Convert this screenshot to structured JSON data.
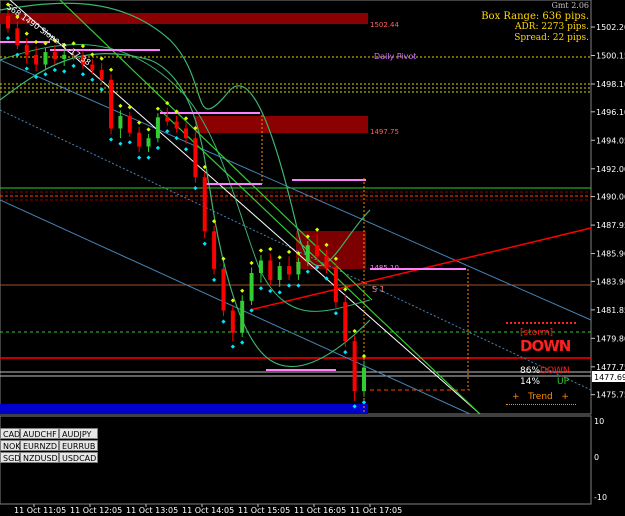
{
  "info_panel": {
    "top_label": "Gmt 2.06",
    "box_range": "Box Range: 636 pips.",
    "adr": "ADR: 2273 pips.",
    "spread": "Spread: 22 pips."
  },
  "trendline_label": "1490 Slope = -17.38",
  "trendline_prefix": "S68",
  "daily_pivot_label": "Daily Pivot",
  "s1_label": "S 1",
  "price_tags": [
    "1502.44",
    "1497.75",
    "1485.10"
  ],
  "current_price": "1477.69",
  "storm_label": "[storm]",
  "down_big": "DOWN",
  "pct_down": "86%",
  "down_word": "DOWN",
  "pct_up": "14%",
  "up_word": "UP",
  "trend_label": "+   Trend   +",
  "lower_axis": [
    "10",
    "0",
    "-10"
  ],
  "pair_buttons": [
    [
      "CAD",
      "AUDCHF",
      "AUDJPY"
    ],
    [
      "NOK",
      "EURNZD",
      "EURRUB"
    ],
    [
      "SGD",
      "NZDUSD",
      "USDCAD"
    ]
  ],
  "chart_data": {
    "type": "candlestick",
    "ylim": [
      1474.5,
      1504
    ],
    "y_ticks": [
      "1502.20",
      "1500.15",
      "1498.10",
      "1496.10",
      "1494.05",
      "1492.00",
      "1490.00",
      "1487.95",
      "1485.90",
      "1483.90",
      "1481.85",
      "1479.80",
      "1477.75",
      "1475.75"
    ],
    "x_ticks": [
      "11 Oct 11:05",
      "11 Oct 12:05",
      "11 Oct 13:05",
      "11 Oct 14:05",
      "11 Oct 15:05",
      "11 Oct 16:05",
      "11 Oct 17:05"
    ],
    "up_color": "#32cd32",
    "down_color": "#ff0000",
    "candles": [
      [
        1503.0,
        1503.5,
        1501.8,
        1502.1
      ],
      [
        1502.1,
        1502.6,
        1500.6,
        1500.9
      ],
      [
        1500.9,
        1501.4,
        1499.6,
        1500.2
      ],
      [
        1500.2,
        1500.8,
        1499.0,
        1499.5
      ],
      [
        1499.5,
        1500.7,
        1499.2,
        1500.4
      ],
      [
        1500.4,
        1500.9,
        1499.5,
        1499.9
      ],
      [
        1499.9,
        1500.6,
        1499.4,
        1500.2
      ],
      [
        1500.2,
        1500.7,
        1499.8,
        1500.1
      ],
      [
        1500.1,
        1500.5,
        1499.2,
        1499.5
      ],
      [
        1499.5,
        1499.9,
        1498.8,
        1499.1
      ],
      [
        1499.1,
        1499.6,
        1498.1,
        1498.4
      ],
      [
        1498.4,
        1498.8,
        1494.5,
        1494.9
      ],
      [
        1494.9,
        1496.2,
        1494.2,
        1495.8
      ],
      [
        1495.8,
        1496.1,
        1494.3,
        1494.6
      ],
      [
        1494.6,
        1495.0,
        1493.2,
        1493.6
      ],
      [
        1493.6,
        1494.5,
        1493.2,
        1494.2
      ],
      [
        1494.2,
        1496.0,
        1493.9,
        1495.7
      ],
      [
        1495.7,
        1496.4,
        1495.1,
        1495.4
      ],
      [
        1495.4,
        1495.8,
        1494.6,
        1494.9
      ],
      [
        1494.9,
        1495.3,
        1493.8,
        1494.2
      ],
      [
        1494.2,
        1494.6,
        1491.0,
        1491.4
      ],
      [
        1491.4,
        1491.8,
        1487.0,
        1487.5
      ],
      [
        1487.5,
        1487.9,
        1484.4,
        1484.8
      ],
      [
        1484.8,
        1485.2,
        1481.4,
        1481.8
      ],
      [
        1481.8,
        1482.2,
        1479.6,
        1480.2
      ],
      [
        1480.2,
        1482.9,
        1479.9,
        1482.5
      ],
      [
        1482.5,
        1484.9,
        1482.2,
        1484.5
      ],
      [
        1484.5,
        1485.8,
        1483.8,
        1485.4
      ],
      [
        1485.4,
        1485.9,
        1483.6,
        1484.0
      ],
      [
        1484.0,
        1485.3,
        1483.5,
        1485.0
      ],
      [
        1485.0,
        1485.7,
        1484.0,
        1484.4
      ],
      [
        1484.4,
        1485.6,
        1484.0,
        1485.3
      ],
      [
        1485.3,
        1486.8,
        1485.0,
        1486.5
      ],
      [
        1486.5,
        1487.3,
        1485.3,
        1485.7
      ],
      [
        1485.7,
        1486.2,
        1484.5,
        1484.9
      ],
      [
        1484.9,
        1485.2,
        1482.0,
        1482.4
      ],
      [
        1482.4,
        1483.0,
        1479.2,
        1479.6
      ],
      [
        1479.6,
        1480.0,
        1475.3,
        1476.0
      ],
      [
        1476.0,
        1478.2,
        1475.6,
        1477.7
      ]
    ],
    "horizontal_levels": [
      {
        "y": 1502.44,
        "color": "#8b0000"
      },
      {
        "y": 1497.75,
        "color": "#8b0000"
      },
      {
        "y": 1500.65,
        "color": "#d4d400"
      },
      {
        "y": 1478.9,
        "color": "#ff0000"
      },
      {
        "y": 1481.2,
        "color": "#32cd32"
      }
    ],
    "bottom_ribbon_color": "#0000cd"
  }
}
